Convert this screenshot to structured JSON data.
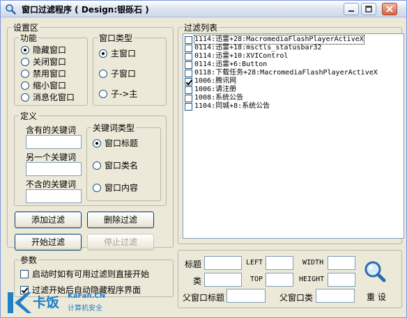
{
  "window": {
    "title": "窗口过滤程序 ( Design:银砾石 )",
    "icon": "magnifier-icon"
  },
  "settings": {
    "legend": "设置区",
    "function": {
      "legend": "功能",
      "options": [
        "隐藏窗口",
        "关闭窗口",
        "禁用窗口",
        "缩小窗口",
        "消息化窗口"
      ],
      "selected": 0
    },
    "window_type": {
      "legend": "窗口类型",
      "options": [
        "主窗口",
        "子窗口",
        "子->主"
      ],
      "selected": 0
    },
    "definition": {
      "legend": "定义",
      "keyword_label": "含有的关键词",
      "keyword_value": "",
      "another_keyword_label": "另一个关键词",
      "another_keyword_value": "",
      "excluded_keyword_label": "不含的关键词",
      "excluded_keyword_value": "",
      "keyword_type": {
        "legend": "关键词类型",
        "options": [
          "窗口标题",
          "窗口类名",
          "窗口内容"
        ],
        "selected": 0
      }
    },
    "buttons": {
      "add_filter": "添加过滤",
      "delete_filter": "删除过滤",
      "start_filter": "开始过滤",
      "stop_filter": "停止过滤"
    }
  },
  "params": {
    "legend": "参数",
    "option1": {
      "label": "启动时如有可用过滤则直接开始",
      "checked": false
    },
    "option2": {
      "label": "过滤开始后自动隐藏程序界面",
      "checked": true
    }
  },
  "filter_list": {
    "legend": "过滤列表",
    "items": [
      {
        "text": "1114:迅雷+28:MacromediaFlashPlayerActiveX",
        "checked": false
      },
      {
        "text": "0114:迅雷+18:msctls_statusbar32",
        "checked": false
      },
      {
        "text": "0114:迅雷+10:XVIControl",
        "checked": false
      },
      {
        "text": "0114:迅雷+6:Button",
        "checked": false
      },
      {
        "text": "0118:下载任务+28:MacromediaFlashPlayerActiveX",
        "checked": false
      },
      {
        "text": "1006:腾讯网",
        "checked": true
      },
      {
        "text": "1006:请注册",
        "checked": false
      },
      {
        "text": "1008:系统公告",
        "checked": false
      },
      {
        "text": "1104:同城+8:系统公告",
        "checked": false
      }
    ]
  },
  "inspector": {
    "title_label": "标题",
    "left_label": "LEFT",
    "width_label": "WIDTH",
    "class_label": "类",
    "top_label": "TOP",
    "height_label": "HEIGHT",
    "parent_title_label": "父窗口标题",
    "parent_class_label": "父窗口类",
    "reset_button": "重 设",
    "finder_icon": "magnifier-icon"
  },
  "watermark": {
    "brand": "卡饭",
    "site": "KaFan.CN",
    "slogan": "计算机安全"
  }
}
